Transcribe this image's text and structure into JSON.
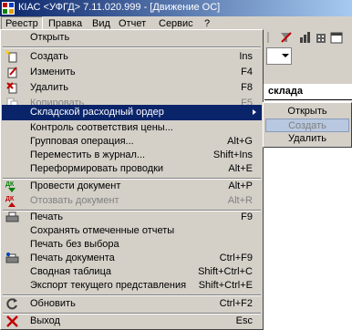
{
  "window": {
    "title": "КІАС <УФГД> 7.11.020.999 - [Движение ОС]",
    "icon": "app-logo-icon"
  },
  "menubar": [
    "Реестр",
    "Правка",
    "Вид",
    "Отчет",
    "Сервис",
    "?"
  ],
  "menu": {
    "items": [
      {
        "label": "Открыть",
        "shortcut": "",
        "icon": ""
      },
      {
        "label": "Создать",
        "shortcut": "Ins",
        "icon": "create-icon"
      },
      {
        "label": "Изменить",
        "shortcut": "F4",
        "icon": "edit-icon"
      },
      {
        "label": "Удалить",
        "shortcut": "F8",
        "icon": "delete-icon"
      },
      {
        "label": "Копировать",
        "shortcut": "F5",
        "icon": "copy-icon"
      },
      {
        "label": "Складской расходный ордер",
        "shortcut": "",
        "icon": ""
      },
      {
        "label": "Контроль соответствия цены...",
        "shortcut": "",
        "icon": ""
      },
      {
        "label": "Групповая операция...",
        "shortcut": "Alt+G",
        "icon": ""
      },
      {
        "label": "Переместить в журнал...",
        "shortcut": "Shift+Ins",
        "icon": ""
      },
      {
        "label": "Переформировать проводки",
        "shortcut": "Alt+E",
        "icon": ""
      },
      {
        "label": "Провести документ",
        "shortcut": "Alt+P",
        "icon": "post-document-icon"
      },
      {
        "label": "Отозвать документ",
        "shortcut": "Alt+R",
        "icon": "revoke-document-icon"
      },
      {
        "label": "Печать",
        "shortcut": "F9",
        "icon": "print-icon"
      },
      {
        "label": "Сохранять отмеченные отчеты",
        "shortcut": "",
        "icon": ""
      },
      {
        "label": "Печать без выбора",
        "shortcut": "",
        "icon": ""
      },
      {
        "label": "Печать документа",
        "shortcut": "Ctrl+F9",
        "icon": "print-document-icon"
      },
      {
        "label": "Сводная таблица",
        "shortcut": "Shift+Ctrl+C",
        "icon": ""
      },
      {
        "label": "Экспорт текущего представления",
        "shortcut": "Shift+Ctrl+E",
        "icon": ""
      },
      {
        "label": "Обновить",
        "shortcut": "Ctrl+F2",
        "icon": "refresh-icon"
      },
      {
        "label": "Выход",
        "shortcut": "Esc",
        "icon": "exit-icon"
      }
    ]
  },
  "submenu": {
    "items": [
      "Открыть",
      "Создать",
      "Удалить"
    ]
  },
  "background": {
    "column_header": "склада"
  },
  "colors": {
    "highlight": "#0a246a",
    "menu_bg": "#d4d0c8",
    "submenu_selected": "#b8c8e0"
  }
}
